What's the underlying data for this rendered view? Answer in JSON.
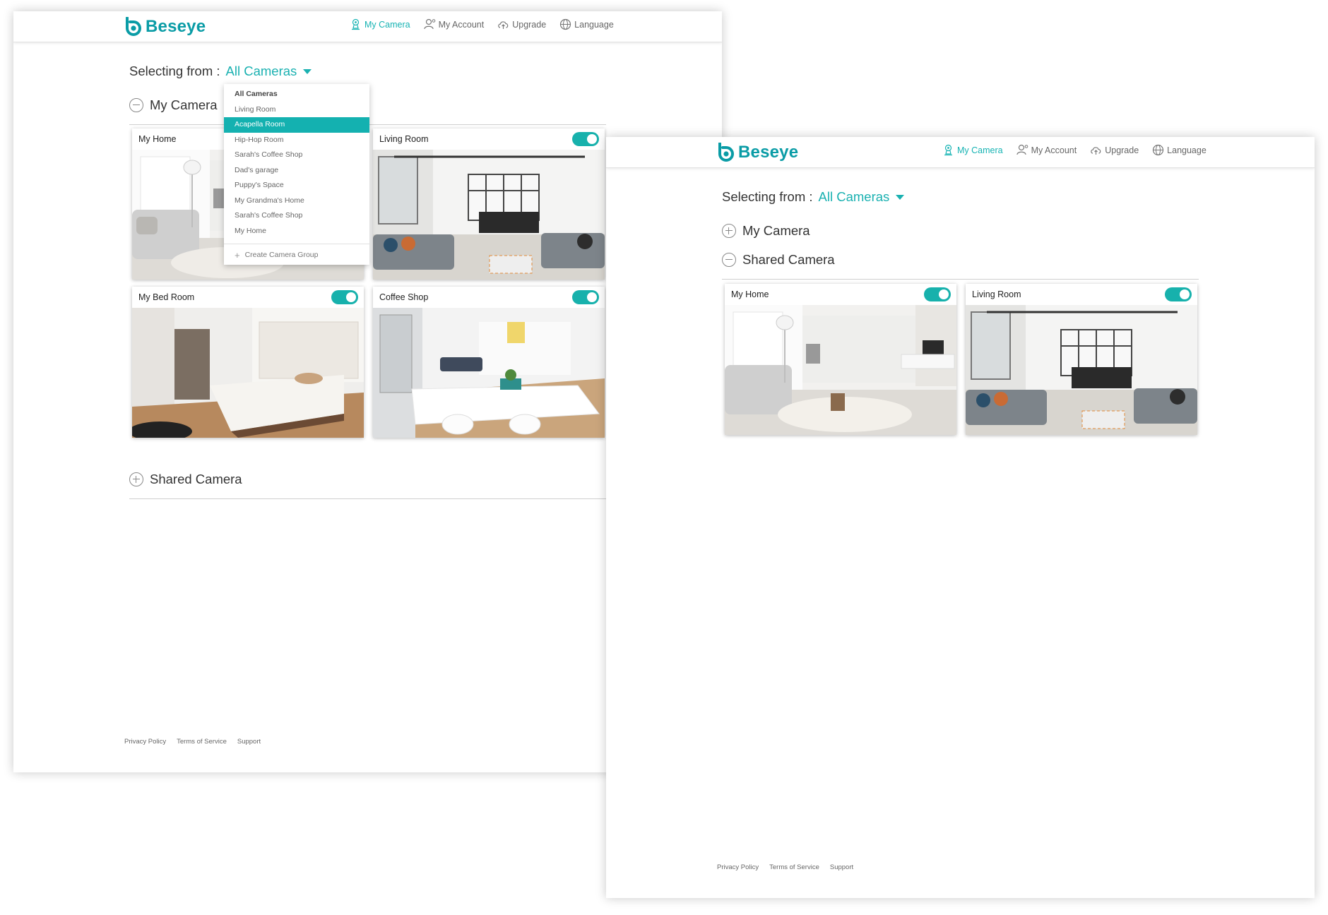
{
  "brand": {
    "name": "Beseye",
    "color": "#0a9ca6",
    "accent": "#16b3b3"
  },
  "nav": [
    {
      "label": "My Camera",
      "icon": "camera-icon",
      "active": true
    },
    {
      "label": "My Account",
      "icon": "user-icon",
      "active": false
    },
    {
      "label": "Upgrade",
      "icon": "cloud-upload-icon",
      "active": false
    },
    {
      "label": "Language",
      "icon": "globe-icon",
      "active": false
    }
  ],
  "selector": {
    "label": "Selecting from :",
    "value": "All Cameras"
  },
  "window_a": {
    "sections": [
      {
        "title": "My Camera",
        "expanded": true
      },
      {
        "title": "Shared Camera",
        "expanded": false
      }
    ],
    "cameras": [
      {
        "name": "My Home",
        "enabled": true,
        "scene": "living-room-rug"
      },
      {
        "name": "Living Room",
        "enabled": true,
        "scene": "loft-dining"
      },
      {
        "name": "My Bed Room",
        "enabled": true,
        "scene": "bedroom"
      },
      {
        "name": "Coffee Shop",
        "enabled": true,
        "scene": "white-dining"
      }
    ],
    "dropdown": {
      "items": [
        {
          "label": "All Cameras",
          "type": "header"
        },
        {
          "label": "Living Room"
        },
        {
          "label": "Acapella Room",
          "selected": true
        },
        {
          "label": "Hip-Hop Room"
        },
        {
          "label": "Sarah's Coffee Shop"
        },
        {
          "label": "Dad's garage"
        },
        {
          "label": "Puppy's Space"
        },
        {
          "label": "My Grandma's Home"
        },
        {
          "label": "Sarah's Coffee Shop"
        },
        {
          "label": "My Home"
        }
      ],
      "create_label": "Create Camera Group"
    }
  },
  "window_b": {
    "sections": [
      {
        "title": "My Camera",
        "expanded": false
      },
      {
        "title": "Shared Camera",
        "expanded": true
      }
    ],
    "cameras": [
      {
        "name": "My Home",
        "enabled": true,
        "scene": "living-room-rug"
      },
      {
        "name": "Living Room",
        "enabled": true,
        "scene": "loft-dining"
      }
    ]
  },
  "footer": [
    "Privacy Policy",
    "Terms of Service",
    "Support"
  ]
}
